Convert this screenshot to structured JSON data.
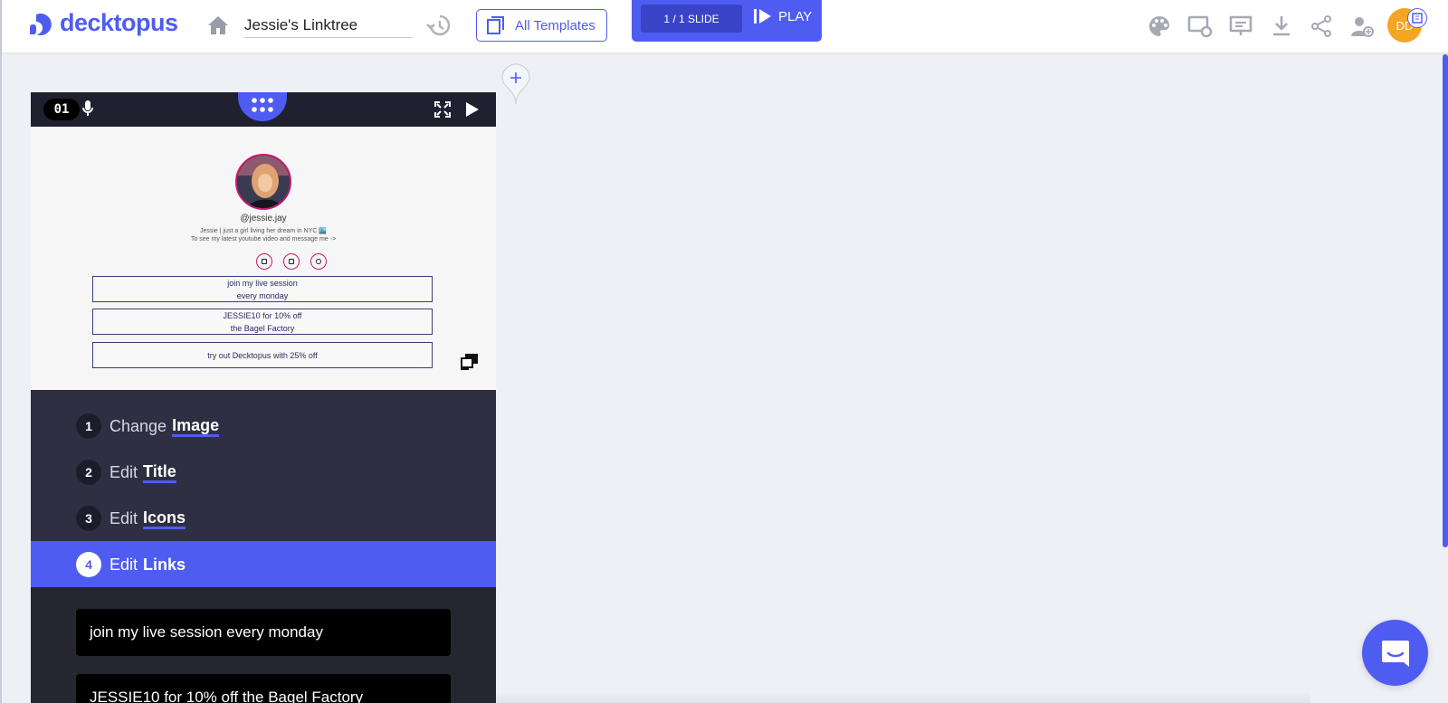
{
  "brand": {
    "name": "decktopus",
    "accent": "#4f5cf2"
  },
  "header": {
    "deck_title": "Jessie's Linktree",
    "templates_label": "All Templates",
    "slide_counter": "1 / 1 SLIDE",
    "play_label": "PLAY",
    "avatar_initials": "DD",
    "toolbar_icons": [
      "palette-icon",
      "slide-settings-icon",
      "presenter-icon",
      "download-icon",
      "share-icon",
      "add-user-icon"
    ]
  },
  "slide": {
    "number": "01",
    "handle": "@jessie.jay",
    "bio_line1": "Jessie | just a girl living her dream in NYC 🏙️",
    "bio_line2": "To see my latest youtube video and message me ->",
    "links": [
      {
        "line1": "join my live session",
        "line2": "every monday"
      },
      {
        "line1": "JESSIE10 for 10% off",
        "line2": "the Bagel Factory"
      },
      {
        "line1": "try out Decktopus with 25% off",
        "line2": ""
      }
    ]
  },
  "steps": [
    {
      "num": "1",
      "verb": "Change",
      "target": "Image"
    },
    {
      "num": "2",
      "verb": "Edit",
      "target": "Title"
    },
    {
      "num": "3",
      "verb": "Edit",
      "target": "Icons"
    },
    {
      "num": "4",
      "verb": "Edit",
      "target": "Links",
      "active": true
    }
  ],
  "link_inputs": [
    "join my live session every monday",
    "JESSIE10 for 10% off the Bagel Factory"
  ]
}
